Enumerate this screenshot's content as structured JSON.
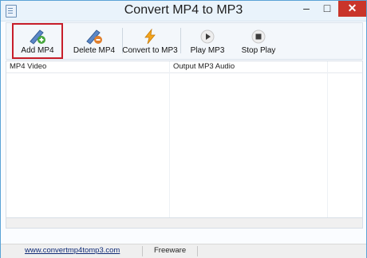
{
  "window": {
    "title": "Convert MP4 to MP3",
    "min_label": "–",
    "max_label": "□",
    "close_label": "✕"
  },
  "toolbar": {
    "buttons": [
      {
        "label": "Add MP4",
        "icon": "film-plus-icon"
      },
      {
        "label": "Delete MP4",
        "icon": "film-minus-icon"
      },
      {
        "label": "Convert to MP3",
        "icon": "lightning-icon"
      },
      {
        "label": "Play MP3",
        "icon": "play-icon"
      },
      {
        "label": "Stop Play",
        "icon": "stop-icon"
      }
    ]
  },
  "table": {
    "columns": [
      "MP4 Video",
      "Output MP3 Audio"
    ]
  },
  "status": {
    "url": "www.convertmp4tomp3.com",
    "edition": "Freeware"
  }
}
